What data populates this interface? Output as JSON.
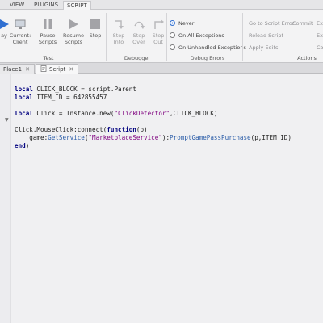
{
  "menu": {
    "items": [
      {
        "label": "VIEW"
      },
      {
        "label": "PLUGINS"
      },
      {
        "label": "SCRIPT"
      }
    ]
  },
  "ribbon": {
    "test": {
      "buttons": [
        {
          "label": "ay",
          "sub": ""
        },
        {
          "label": "Current:",
          "sub": "Client"
        },
        {
          "label": "Pause",
          "sub": "Scripts"
        },
        {
          "label": "Resume",
          "sub": "Scripts"
        },
        {
          "label": "Stop",
          "sub": ""
        }
      ],
      "group_label": "Test"
    },
    "debugger": {
      "buttons": [
        {
          "label": "Step",
          "sub": "Into"
        },
        {
          "label": "Step",
          "sub": "Over"
        },
        {
          "label": "Step",
          "sub": "Out"
        }
      ],
      "group_label": "Debugger"
    },
    "debug_errors": {
      "options": [
        {
          "label": "Never",
          "selected": true
        },
        {
          "label": "On All Exceptions",
          "selected": false
        },
        {
          "label": "On Unhandled Exceptions",
          "selected": false
        }
      ],
      "group_label": "Debug Errors"
    },
    "actions": {
      "items": [
        "Go to Script Error",
        "Commit",
        "Reload Script",
        "Apply Edits"
      ],
      "right_items": [
        "Ex",
        "Ex",
        "Co"
      ],
      "group_label": "Actions"
    },
    "colors": {
      "accent": "#2f6fd1",
      "icon_blue": "#3a7de0",
      "icon_gray": "#8e8e92"
    }
  },
  "tabs": [
    {
      "label": "Place1",
      "active": false
    },
    {
      "label": "Script",
      "active": true
    }
  ],
  "code": {
    "lines": [
      "local CLICK_BLOCK = script.Parent",
      "local ITEM_ID = 642855457",
      "",
      "local Click = Instance.new(\"ClickDetector\",CLICK_BLOCK)",
      "",
      "Click.MouseClick:connect(function(p)",
      "    game:GetService(\"MarketplaceService\"):PromptGamePassPurchase(p,ITEM_ID)",
      "end)"
    ]
  }
}
